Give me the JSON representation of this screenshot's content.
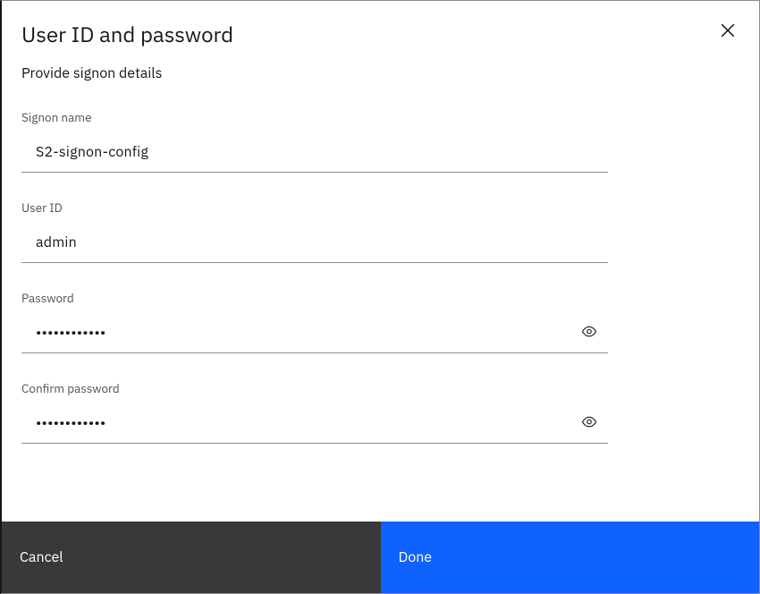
{
  "dialog": {
    "title": "User ID and password",
    "subtitle": "Provide signon details"
  },
  "fields": {
    "signon_name": {
      "label": "Signon name",
      "value": "S2-signon-config"
    },
    "user_id": {
      "label": "User ID",
      "value": "admin"
    },
    "password": {
      "label": "Password",
      "value": "••••••••••••"
    },
    "confirm_password": {
      "label": "Confirm password",
      "value": "••••••••••••"
    }
  },
  "footer": {
    "cancel_label": "Cancel",
    "done_label": "Done"
  },
  "icons": {
    "close": "close-icon",
    "eye": "eye-icon"
  }
}
